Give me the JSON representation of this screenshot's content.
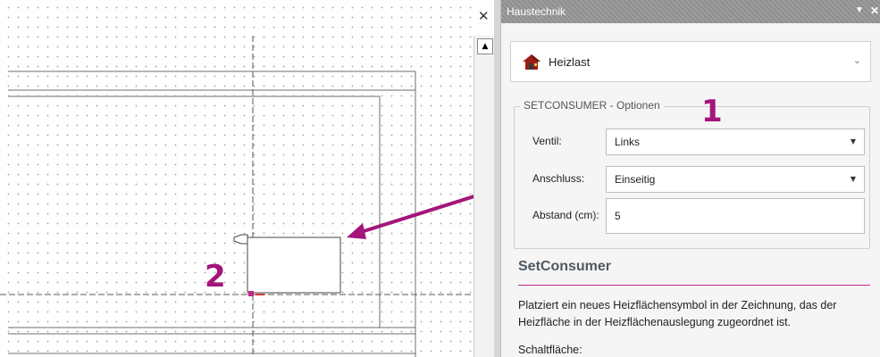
{
  "canvas": {
    "annotation_number": "2"
  },
  "window": {
    "close_symbol": "✕"
  },
  "scrollbar": {
    "up_arrow": "▲"
  },
  "panel": {
    "title": "Haustechnik",
    "menu_symbol": "▼",
    "close_symbol": "✕",
    "mode_dropdown": {
      "label": "Heizlast",
      "icon": "heizlast-house-icon",
      "chevron": "⌄"
    },
    "options": {
      "legend": "SETCONSUMER - Optionen",
      "annotation_number": "1",
      "ventil": {
        "label": "Ventil:",
        "value": "Links",
        "arrow": "▼"
      },
      "anschluss": {
        "label": "Anschluss:",
        "value": "Einseitig",
        "arrow": "▼"
      },
      "abstand": {
        "label": "Abstand (cm):",
        "value": "5"
      }
    },
    "help": {
      "title": "SetConsumer",
      "text": "Platziert ein neues Heizflächensymbol in der Zeichnung, das der Heizfläche in der Heizflächenauslegung zugeordnet ist.",
      "subheading": "Schaltfläche:"
    }
  },
  "colors": {
    "annotation": "#a3157a",
    "accent_rule": "#c2298a",
    "titlebar": "#8e8e8e"
  }
}
